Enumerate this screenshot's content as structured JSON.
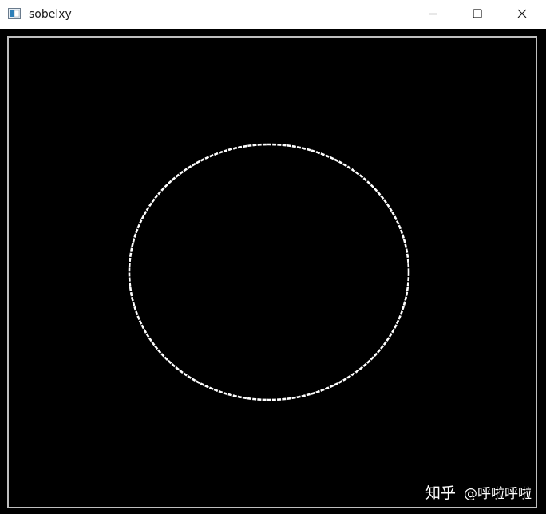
{
  "window": {
    "title": "sobelxy",
    "icon": "opencv-window-icon",
    "controls": {
      "minimize": "minimize-icon",
      "maximize": "maximize-icon",
      "close": "close-icon"
    }
  },
  "canvas": {
    "background": "#000000",
    "stroke_color": "#ffffff",
    "border_color": "#bfbfbf",
    "content": "ellipse-edge"
  },
  "watermark": {
    "brand": "知乎",
    "handle": "@呼啦呼啦"
  }
}
